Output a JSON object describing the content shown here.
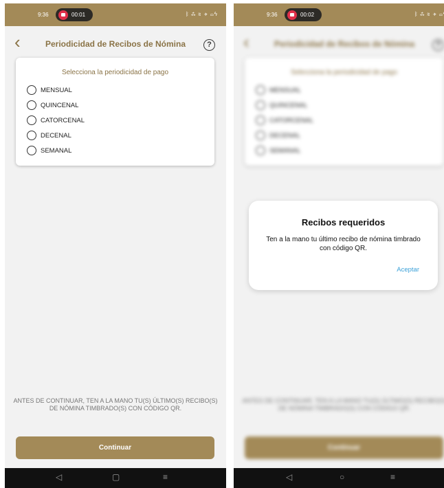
{
  "left": {
    "status": {
      "time": "9:36",
      "record_time": "00:01",
      "icons": "ᛒ ⁂ ≋ ✈ ▭ϟ"
    },
    "header": {
      "back": "‹",
      "title": "Periodicidad de Recibos de Nómina",
      "help": "?"
    },
    "card": {
      "title": "Selecciona la periodicidad de pago",
      "options": [
        "MENSUAL",
        "QUINCENAL",
        "CATORCENAL",
        "DECENAL",
        "SEMANAL"
      ]
    },
    "bottom_note": "ANTES DE CONTINUAR, TEN A LA MANO TU(S) ÚLTIMO(S) RECIBO(S) DE NÓMINA TIMBRADO(S) CON CÓDIGO QR.",
    "continue_label": "Continuar",
    "nav": {
      "back": "◁",
      "home": "▢",
      "menu": "≡"
    }
  },
  "right": {
    "status": {
      "time": "9:36",
      "record_time": "00:02",
      "icons": "ᛒ ⁂ ≋ ✈ ▭ϟ"
    },
    "modal": {
      "title": "Recibos requeridos",
      "body": "Ten a la mano tu último recibo de nómina timbrado con código QR.",
      "accept_label": "Aceptar"
    },
    "nav": {
      "back": "◁",
      "home": "○",
      "menu": "≡"
    }
  }
}
